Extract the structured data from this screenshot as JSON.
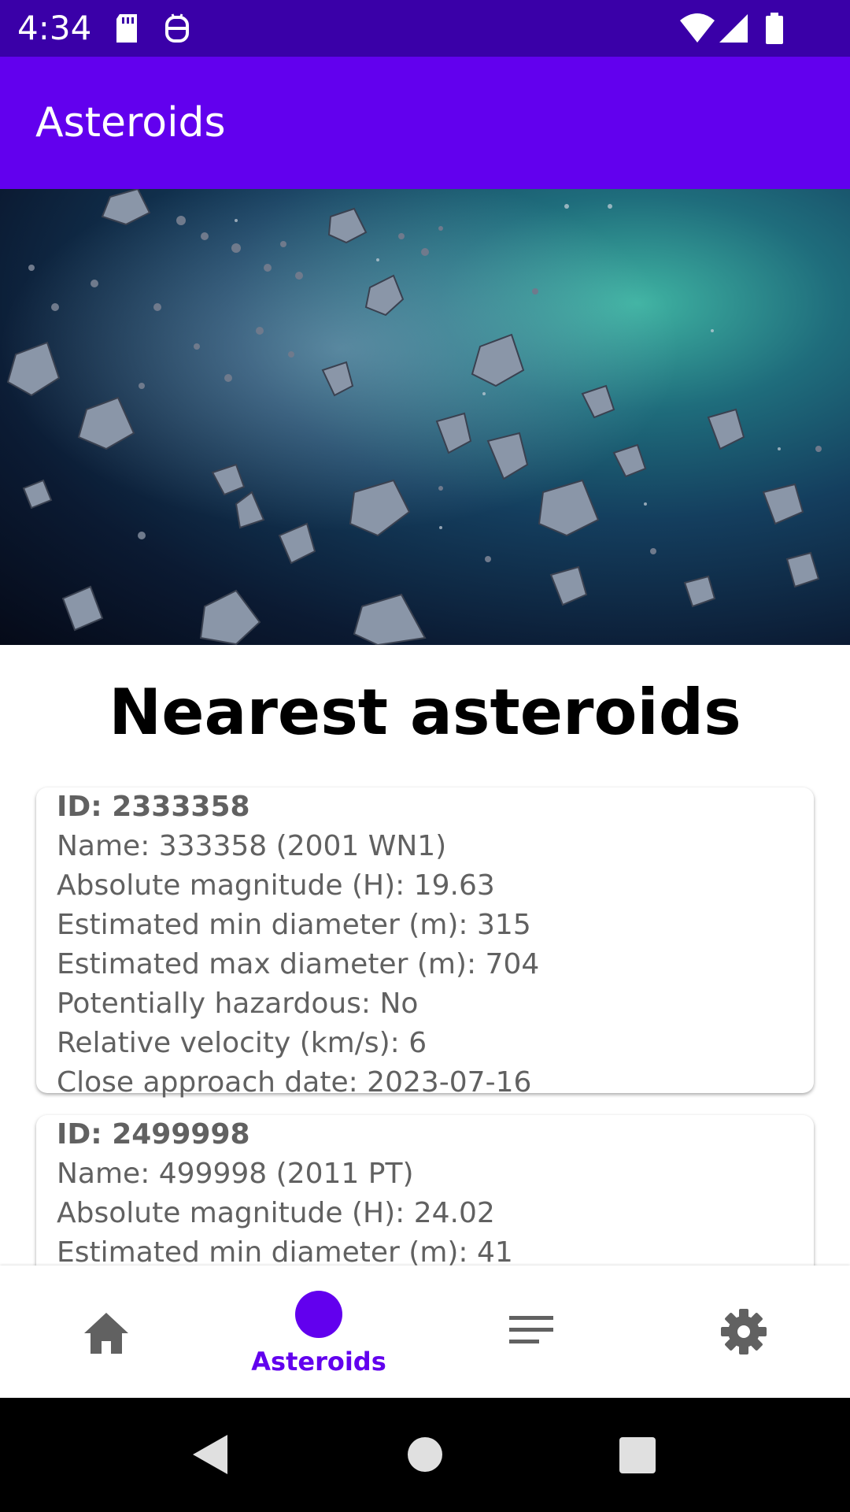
{
  "status_bar": {
    "time": "4:34",
    "left_icons": [
      "sd-card-icon",
      "android-debug-icon"
    ],
    "right_icons": [
      "wifi-icon",
      "signal-icon",
      "battery-icon"
    ]
  },
  "app_bar": {
    "title": "Asteroids"
  },
  "hero": {
    "image": "asteroid-field-image"
  },
  "section_title": "Nearest asteroids",
  "asteroids": [
    {
      "id_line": "ID: 2333358",
      "name_line": "Name: 333358 (2001 WN1)",
      "magnitude_line": "Absolute magnitude (H): 19.63",
      "min_diameter_line": "Estimated min diameter (m): 315",
      "max_diameter_line": "Estimated max diameter (m): 704",
      "hazardous_line": "Potentially hazardous: No",
      "velocity_line": "Relative velocity (km/s): 6",
      "approach_line": "Close approach date: 2023-07-16"
    },
    {
      "id_line": "ID: 2499998",
      "name_line": "Name: 499998 (2011 PT)",
      "magnitude_line": "Absolute magnitude (H): 24.02",
      "min_diameter_line": "Estimated min diameter (m): 41"
    }
  ],
  "bottom_nav": {
    "items": [
      {
        "icon": "home-icon",
        "label": ""
      },
      {
        "icon": "asteroids-dot-icon",
        "label": "Asteroids",
        "active": true
      },
      {
        "icon": "list-icon",
        "label": ""
      },
      {
        "icon": "settings-icon",
        "label": ""
      }
    ]
  },
  "colors": {
    "primary": "#6200ee",
    "primary_dark": "#3700b3",
    "card_text": "#616161",
    "nav_icon": "#616161"
  }
}
